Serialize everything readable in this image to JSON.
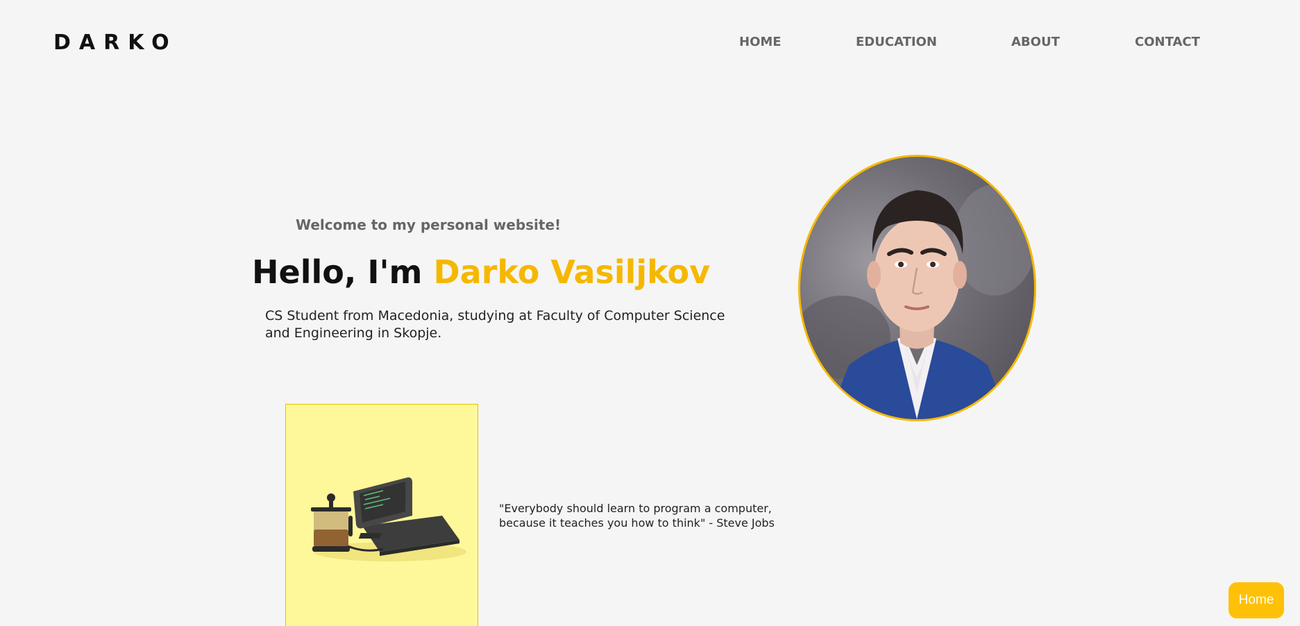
{
  "header": {
    "logo": "DARKO",
    "nav": [
      "HOME",
      "EDUCATION",
      "ABOUT",
      "CONTACT"
    ]
  },
  "hero": {
    "welcome": "Welcome to my personal website!",
    "greeting": "Hello, I'm ",
    "name": "Darko Vasiljkov",
    "intro": "CS Student from Macedonia, studying at Faculty of Computer Science and Engineering in Skopje."
  },
  "quote": "\"Everybody should learn to program a computer, because it teaches you how to think\" - Steve Jobs",
  "home_button": "Home",
  "colors": {
    "accent": "#f5b800",
    "background": "#f5f5f5",
    "card": "#fff89a",
    "button": "#ffc107"
  },
  "icons": {
    "portrait": "profile-photo",
    "card_illustration": "laptop-and-coffee-press"
  }
}
